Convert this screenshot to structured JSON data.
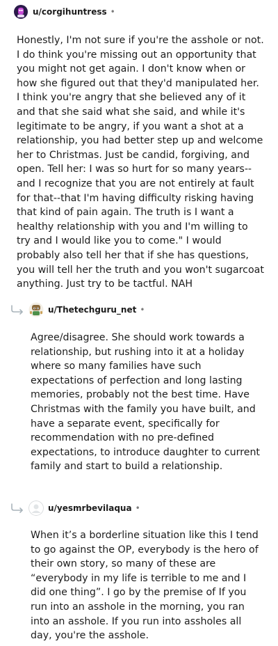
{
  "comments": [
    {
      "username": "u/corgihuntress",
      "separator": "•",
      "body": "Honestly, I'm not sure if you're the asshole or not. I do think you're missing out an opportunity that you might not get again. I don't know when or how she figured out that they'd manipulated her. I think you're angry that she believed any of it and that she said what she said, and while it's legitimate to be angry, if you want a shot at a relationship, you had better step up and welcome her to Christmas. Just be candid, forgiving, and open. Tell her: I was so hurt for so many years--and I recognize that you are not entirely at fault for that--that I'm having difficulty risking having that kind of pain again. The truth is I want a healthy relationship with you and I'm willing to try and I would like you to come.\" I would probably also tell her that if she has questions, you will tell her the truth and you won't sugarcoat anything. Just try to be tactful. NAH"
    },
    {
      "username": "u/Thetechguru_net",
      "separator": "•",
      "body": "Agree/disagree. She should work towards a relationship, but rushing into it at a holiday where so many families have such expectations of perfection and long lasting memories, probably not the best time. Have Christmas with the family you have built, and have a separate event, specifically for recommendation with no pre-defined expectations, to introduce daughter to current family and start to build a relationship."
    },
    {
      "username": "u/yesmrbevilaqua",
      "separator": "•",
      "body": "When it’s a borderline situation like this I tend to go against the OP, everybody is the hero of their own story, so many of these are “everybody in my life is terrible to me and I did one thing”. I go by the premise of If you run into an asshole in the morning, you ran into an asshole. If you run into assholes all day, you're the asshole."
    }
  ],
  "colors": {
    "text": "#1c1c1c",
    "meta": "#7c7c7c",
    "reply_arrow": "#a8b3ba",
    "avatar1_bg": "#2b1a4a",
    "avatar1_accent": "#c74bd6"
  },
  "icons": {
    "avatar1": "snoo-avatar-purple-icon",
    "avatar2": "snoo-avatar-character-icon",
    "avatar3": "default-avatar-icon",
    "reply": "reply-arrow-icon"
  }
}
